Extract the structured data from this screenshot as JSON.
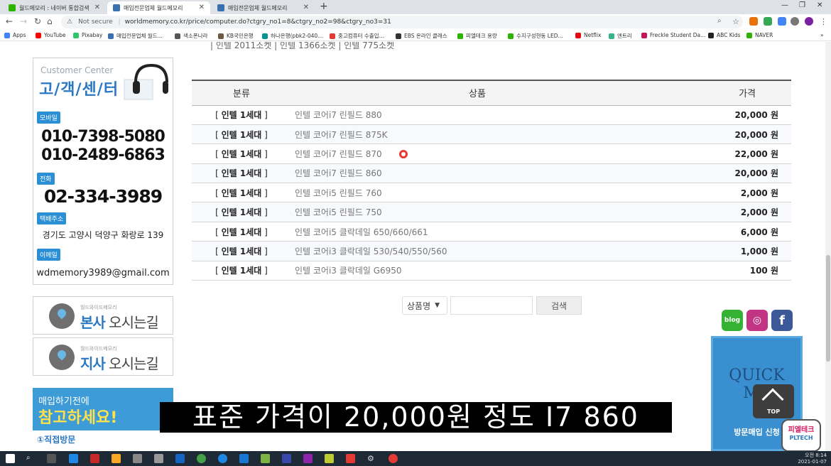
{
  "browser": {
    "tabs": [
      {
        "title": "월드메모리 : 네이버 통합검색",
        "color": "#2db400"
      },
      {
        "title": "매입전문업체 월드메모리",
        "color": "#3a6fb0"
      },
      {
        "title": "매입전문업체 월드메모리",
        "color": "#3a6fb0"
      }
    ],
    "address": {
      "security": "Not secure",
      "url": "worldmemory.co.kr/price/computer.do?ctgry_no1=8&ctgry_no2=98&ctgry_no3=31"
    },
    "bookmarks": [
      {
        "label": "Apps",
        "color": "#4285f4"
      },
      {
        "label": "YouTube",
        "color": "#ff0000"
      },
      {
        "label": "Pixabay",
        "color": "#2ec66d"
      },
      {
        "label": "매입전문업체 월드...",
        "color": "#3a6fb0"
      },
      {
        "label": "색소폰나라",
        "color": "#555555"
      },
      {
        "label": "KB국민은행",
        "color": "#6b5a3e"
      },
      {
        "label": "하나은행(pbk2-040...",
        "color": "#009490"
      },
      {
        "label": "중고컴퓨터 수출입...",
        "color": "#e53935"
      },
      {
        "label": "EBS 온라인 클래스",
        "color": "#333333"
      },
      {
        "label": "피엘테크 용량",
        "color": "#2db400"
      },
      {
        "label": "수지구성현동 LED...",
        "color": "#2db400"
      },
      {
        "label": "Netflix",
        "color": "#e50914"
      },
      {
        "label": "엔트리",
        "color": "#38b48b"
      },
      {
        "label": "Freckle Student Da...",
        "color": "#c2185b"
      },
      {
        "label": "ABC Kids",
        "color": "#222222"
      },
      {
        "label": "NAVER",
        "color": "#2db400"
      }
    ]
  },
  "top_cut_text": "| 인텔 2011소켓 | 인텔 1366소켓 | 인텔 775소켓",
  "customer_center": {
    "en_title": "Customer Center",
    "ko_title": "고/객/센/터",
    "mobile_label": "모바일",
    "mobile_1": "010-7398-5080",
    "mobile_2": "010-2489-6863",
    "phone_label": "전화",
    "phone": "02-334-3989",
    "address_label": "택배주소",
    "address": "경기도 고양시 덕양구 화랑로 139",
    "email_label": "이메일",
    "email": "wdmemory3989@gmail.com"
  },
  "locations": [
    {
      "small": "월드와이드메모리",
      "bold": "본사",
      "rest": " 오시는길"
    },
    {
      "small": "월드와이드메모리",
      "bold": "지사",
      "rest": " 오시는길"
    }
  ],
  "notice": {
    "line1": "매입하기전에",
    "line2": "참고하세요!",
    "line3": "①직접방문"
  },
  "table": {
    "headers": [
      "분류",
      "상품",
      "가격"
    ],
    "rows": [
      {
        "cat": "인텔 1세대",
        "prod": "인텔 코어i7 린필드 880",
        "price": "20,000 원"
      },
      {
        "cat": "인텔 1세대",
        "prod": "인텔 코어i7 린필드 875K",
        "price": "20,000 원"
      },
      {
        "cat": "인텔 1세대",
        "prod": "인텔 코어i7 린필드 870",
        "price": "22,000 원"
      },
      {
        "cat": "인텔 1세대",
        "prod": "인텔 코어i7 린필드 860",
        "price": "20,000 원"
      },
      {
        "cat": "인텔 1세대",
        "prod": "인텔 코어i5 린필드 760",
        "price": "2,000 원"
      },
      {
        "cat": "인텔 1세대",
        "prod": "인텔 코어i5 린필드 750",
        "price": "2,000 원"
      },
      {
        "cat": "인텔 1세대",
        "prod": "인텔 코어i5 클락데일 650/660/661",
        "price": "6,000 원"
      },
      {
        "cat": "인텔 1세대",
        "prod": "인텔 코어i3 클락데일 530/540/550/560",
        "price": "1,000 원"
      },
      {
        "cat": "인텔 1세대",
        "prod": "인텔 코어i3 클락데일 G6950",
        "price": "100 원"
      }
    ]
  },
  "search": {
    "select_value": "상품명",
    "input_value": "",
    "button": "검색"
  },
  "social": {
    "blog": "blog"
  },
  "quick_menu": {
    "title": "QUICK ME",
    "apply": "방문매입 신청"
  },
  "top_button": "TOP",
  "subtitle": "표준 가격이 20,000원 정도 I7 860",
  "watermark": {
    "line1": "피엘테크",
    "line2": "PLTECH"
  },
  "clock": {
    "time": "오전 8:14",
    "date": "2021-01-07"
  }
}
